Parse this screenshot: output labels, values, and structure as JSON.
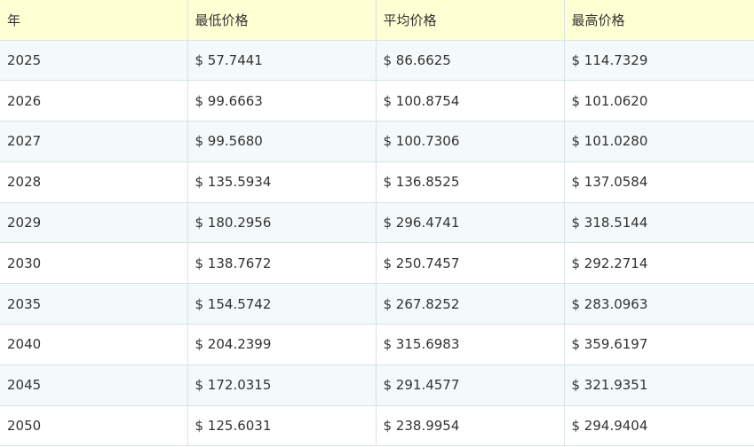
{
  "table": {
    "headers": [
      "年",
      "最低价格",
      "平均价格",
      "最高价格"
    ],
    "rows": [
      [
        "2025",
        "$ 57.7441",
        "$ 86.6625",
        "$ 114.7329"
      ],
      [
        "2026",
        "$ 99.6663",
        "$ 100.8754",
        "$ 101.0620"
      ],
      [
        "2027",
        "$ 99.5680",
        "$ 100.7306",
        "$ 101.0280"
      ],
      [
        "2028",
        "$ 135.5934",
        "$ 136.8525",
        "$ 137.0584"
      ],
      [
        "2029",
        "$ 180.2956",
        "$ 296.4741",
        "$ 318.5144"
      ],
      [
        "2030",
        "$ 138.7672",
        "$ 250.7457",
        "$ 292.2714"
      ],
      [
        "2035",
        "$ 154.5742",
        "$ 267.8252",
        "$ 283.0963"
      ],
      [
        "2040",
        "$ 204.2399",
        "$ 315.6983",
        "$ 359.6197"
      ],
      [
        "2045",
        "$ 172.0315",
        "$ 291.4577",
        "$ 321.9351"
      ],
      [
        "2050",
        "$ 125.6031",
        "$ 238.9954",
        "$ 294.9404"
      ]
    ]
  },
  "colors": {
    "header_bg": "#ffffd4",
    "row_alt_bg": "#f4f9f9",
    "border": "#d6e3e6",
    "text": "#333333"
  }
}
